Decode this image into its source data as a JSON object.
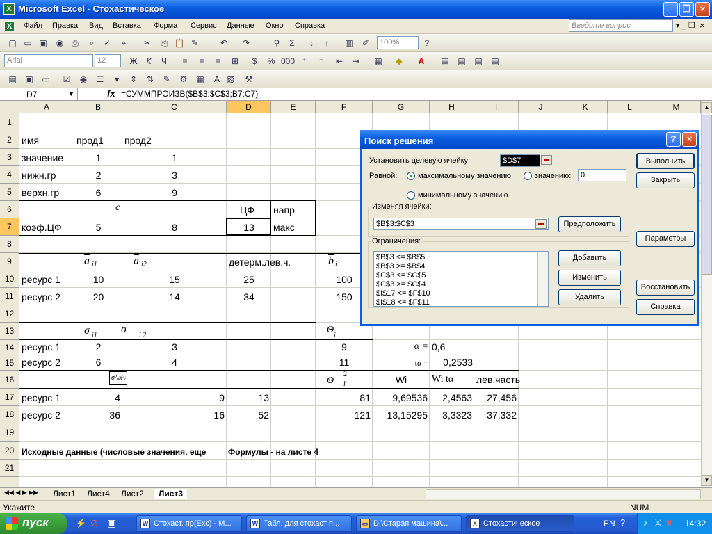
{
  "window": {
    "title": "Microsoft Excel - Стохастическое"
  },
  "menu": [
    "Файл",
    "Правка",
    "Вид",
    "Вставка",
    "Формат",
    "Сервис",
    "Данные",
    "Окно",
    "Справка"
  ],
  "question_box": "Введите вопрос",
  "toolbar": {
    "zoom": "100%",
    "font": "Arial",
    "size": "12"
  },
  "formula_bar": {
    "name_box": "D7",
    "fx": "fx",
    "formula": "=СУММПРОИЗВ($B$3:$C$3;B7:C7)"
  },
  "columns": [
    "A",
    "B",
    "C",
    "D",
    "E",
    "F",
    "G",
    "H",
    "I",
    "J",
    "K",
    "L",
    "M"
  ],
  "rows": [
    "1",
    "2",
    "3",
    "4",
    "5",
    "6",
    "7",
    "8",
    "9",
    "10",
    "11",
    "12",
    "13",
    "14",
    "15",
    "16",
    "17",
    "18",
    "19",
    "20",
    "21"
  ],
  "cells": {
    "A2": "имя",
    "B2": "прод1",
    "C2": "прод2",
    "A3": "значение",
    "B3": "1",
    "C3": "1",
    "A4": "нижн.гр",
    "B4": "2",
    "C4": "3",
    "A5": "верхн.гр",
    "B5": "6",
    "C5": "9",
    "C6": "c",
    "D6": "ЦФ",
    "E6": "напр",
    "A7": "коэф.ЦФ",
    "B7": "5",
    "C7": "8",
    "D7": "13",
    "E7": "макс",
    "B9": "a",
    "B9s": "i1",
    "C9": "a",
    "C9s": "i2",
    "D9": "детерм.лев.ч.",
    "F9": "b",
    "F9s": "i",
    "A10": "ресурс 1",
    "B10": "10",
    "C10": "15",
    "D10": "25",
    "F10": "100",
    "A11": "ресурс 2",
    "B11": "20",
    "C11": "14",
    "D11": "34",
    "F11": "150",
    "B13": "σ",
    "B13s": "i1",
    "C13": "σ",
    "C13s": "i 2",
    "F13": "Θ",
    "F13s": "i",
    "A14": "ресурс 1",
    "B14": "2",
    "C14": "3",
    "F14": "9",
    "G14": "α =",
    "H14": "0,6",
    "A15": "ресурс 2",
    "B15": "6",
    "C15": "4",
    "F15": "11",
    "G15": "tα =",
    "H15": "0,2533",
    "B16": "σ²ᵢⱼx²ⱼ",
    "F16": "Θ",
    "F16s": "2",
    "F16b": "i",
    "G16": "Wi",
    "H16": "Wi tα",
    "I16": "лев.часть",
    "A17": "ресурс 1",
    "B17": "4",
    "C17": "9",
    "D17": "13",
    "F17": "81",
    "G17": "9,69536",
    "H17": "2,4563",
    "I17": "27,456",
    "A18": "ресурс 2",
    "B18": "36",
    "C18": "16",
    "D18": "52",
    "F18": "121",
    "G18": "13,15295",
    "H18": "3,3323",
    "I18": "37,332",
    "A20": "Исходные данные (числовые значения, еще",
    "D20": "Формулы - на листе 4"
  },
  "sheet_tabs": [
    "Лист1",
    "Лист4",
    "Лист2",
    "Лист3"
  ],
  "status": {
    "left": "Укажите",
    "num": "NUM"
  },
  "dialog": {
    "title": "Поиск решения",
    "target_label": "Установить целевую ячейку:",
    "target_value": "$D$7",
    "equal_label": "Равной:",
    "opt_max": "максимальному значению",
    "opt_value": "значению:",
    "value_input": "0",
    "opt_min": "минимальному значению",
    "changing_label": "Изменяя ячейки:",
    "changing_value": "$B$3:$C$3",
    "constraints_label": "Ограничения:",
    "constraints": [
      "$B$3 <= $B$5",
      "$B$3 >= $B$4",
      "$C$3 <= $C$5",
      "$C$3 >= $C$4",
      "$I$17 <= $F$10",
      "$I$18 <= $F$11"
    ],
    "btn_solve": "Выполнить",
    "btn_close": "Закрыть",
    "btn_guess": "Предположить",
    "btn_options": "Параметры",
    "btn_add": "Добавить",
    "btn_change": "Изменить",
    "btn_delete": "Удалить",
    "btn_reset": "Восстановить",
    "btn_help": "Справка"
  },
  "taskbar": {
    "start": "пуск",
    "tasks": [
      "Стохаст. пр(Exc) - M...",
      "Табл. для стохаст п...",
      "D:\\Старая машина\\...",
      "Стохастическое"
    ],
    "lang": "EN",
    "time": "14:32"
  }
}
